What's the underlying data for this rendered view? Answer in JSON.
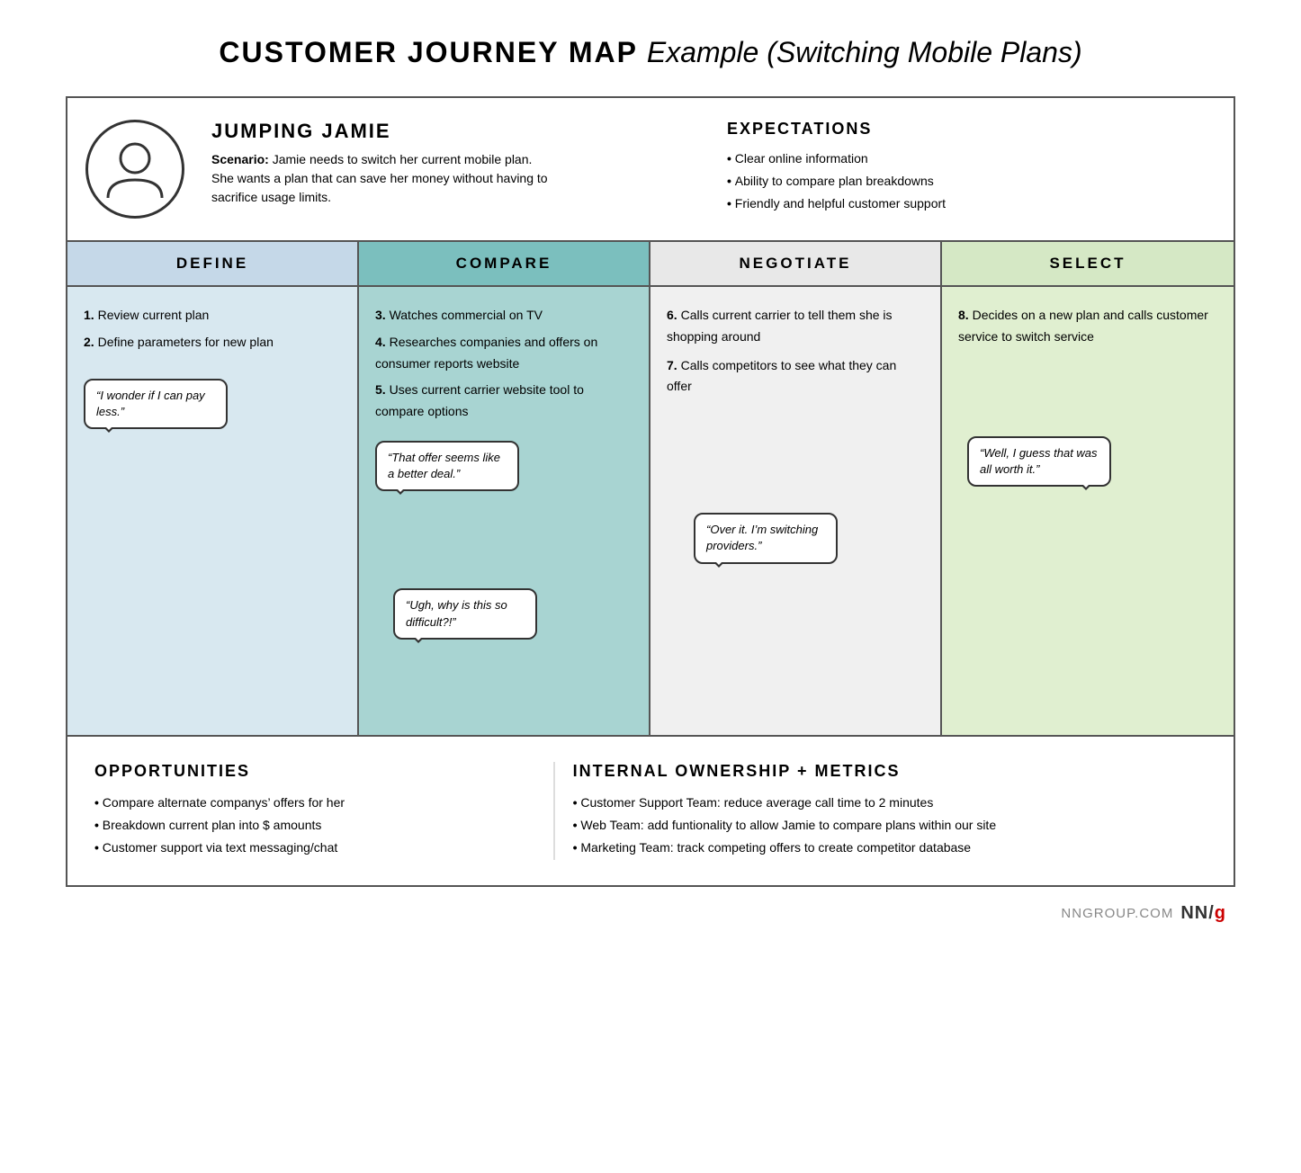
{
  "page": {
    "title_bold": "CUSTOMER JOURNEY MAP",
    "title_italic": "Example (Switching Mobile Plans)"
  },
  "persona": {
    "name": "JUMPING JAMIE",
    "scenario_label": "Scenario:",
    "scenario_text": "Jamie needs to switch her current mobile plan. She wants a plan that can save her money without having to sacrifice usage limits."
  },
  "expectations": {
    "title": "EXPECTATIONS",
    "items": [
      "Clear online information",
      "Ability to compare plan breakdowns",
      "Friendly and helpful customer support"
    ]
  },
  "phases": [
    {
      "id": "define",
      "label": "DEFINE"
    },
    {
      "id": "compare",
      "label": "COMPARE"
    },
    {
      "id": "negotiate",
      "label": "NEGOTIATE"
    },
    {
      "id": "select",
      "label": "SELECT"
    }
  ],
  "phase_define": {
    "steps": [
      {
        "num": "1.",
        "text": "Review current plan"
      },
      {
        "num": "2.",
        "text": "Define parameters for new plan"
      }
    ],
    "bubble": "“I wonder if I can pay less.”"
  },
  "phase_compare": {
    "steps": [
      {
        "num": "3.",
        "text": "Watches commercial on TV"
      },
      {
        "num": "4.",
        "text": "Researches companies and offers on consumer reports website"
      },
      {
        "num": "5.",
        "text": "Uses current carrier website tool to compare options"
      }
    ],
    "bubble_high": "“That offer seems like a better deal.”",
    "bubble_low": "“Ugh, why is this so difficult?!”"
  },
  "phase_negotiate": {
    "steps": [
      {
        "num": "6.",
        "text": "Calls current carrier to tell them she is shopping around"
      },
      {
        "num": "7.",
        "text": "Calls competitors to see what they can offer"
      }
    ],
    "bubble": "“Over it. I’m switching providers.”"
  },
  "phase_select": {
    "steps": [
      {
        "num": "8.",
        "text": "Decides on a new plan and calls customer service to switch service"
      }
    ],
    "bubble": "“Well, I guess that was all worth it.”"
  },
  "opportunities": {
    "title": "OPPORTUNITIES",
    "items": [
      "Compare alternate companys’ offers for her",
      "Breakdown current plan into $ amounts",
      "Customer support via text messaging/chat"
    ]
  },
  "internal": {
    "title": "INTERNAL OWNERSHIP + METRICS",
    "items": [
      "Customer Support Team: reduce average call time to 2 minutes",
      "Web Team: add funtionality to allow Jamie to compare plans within our site",
      "Marketing Team: track competing offers to create competitor database"
    ]
  },
  "footer": {
    "site": "NNGROUP.COM",
    "logo": "NN",
    "logo_slash": "/",
    "logo_g": "g"
  }
}
